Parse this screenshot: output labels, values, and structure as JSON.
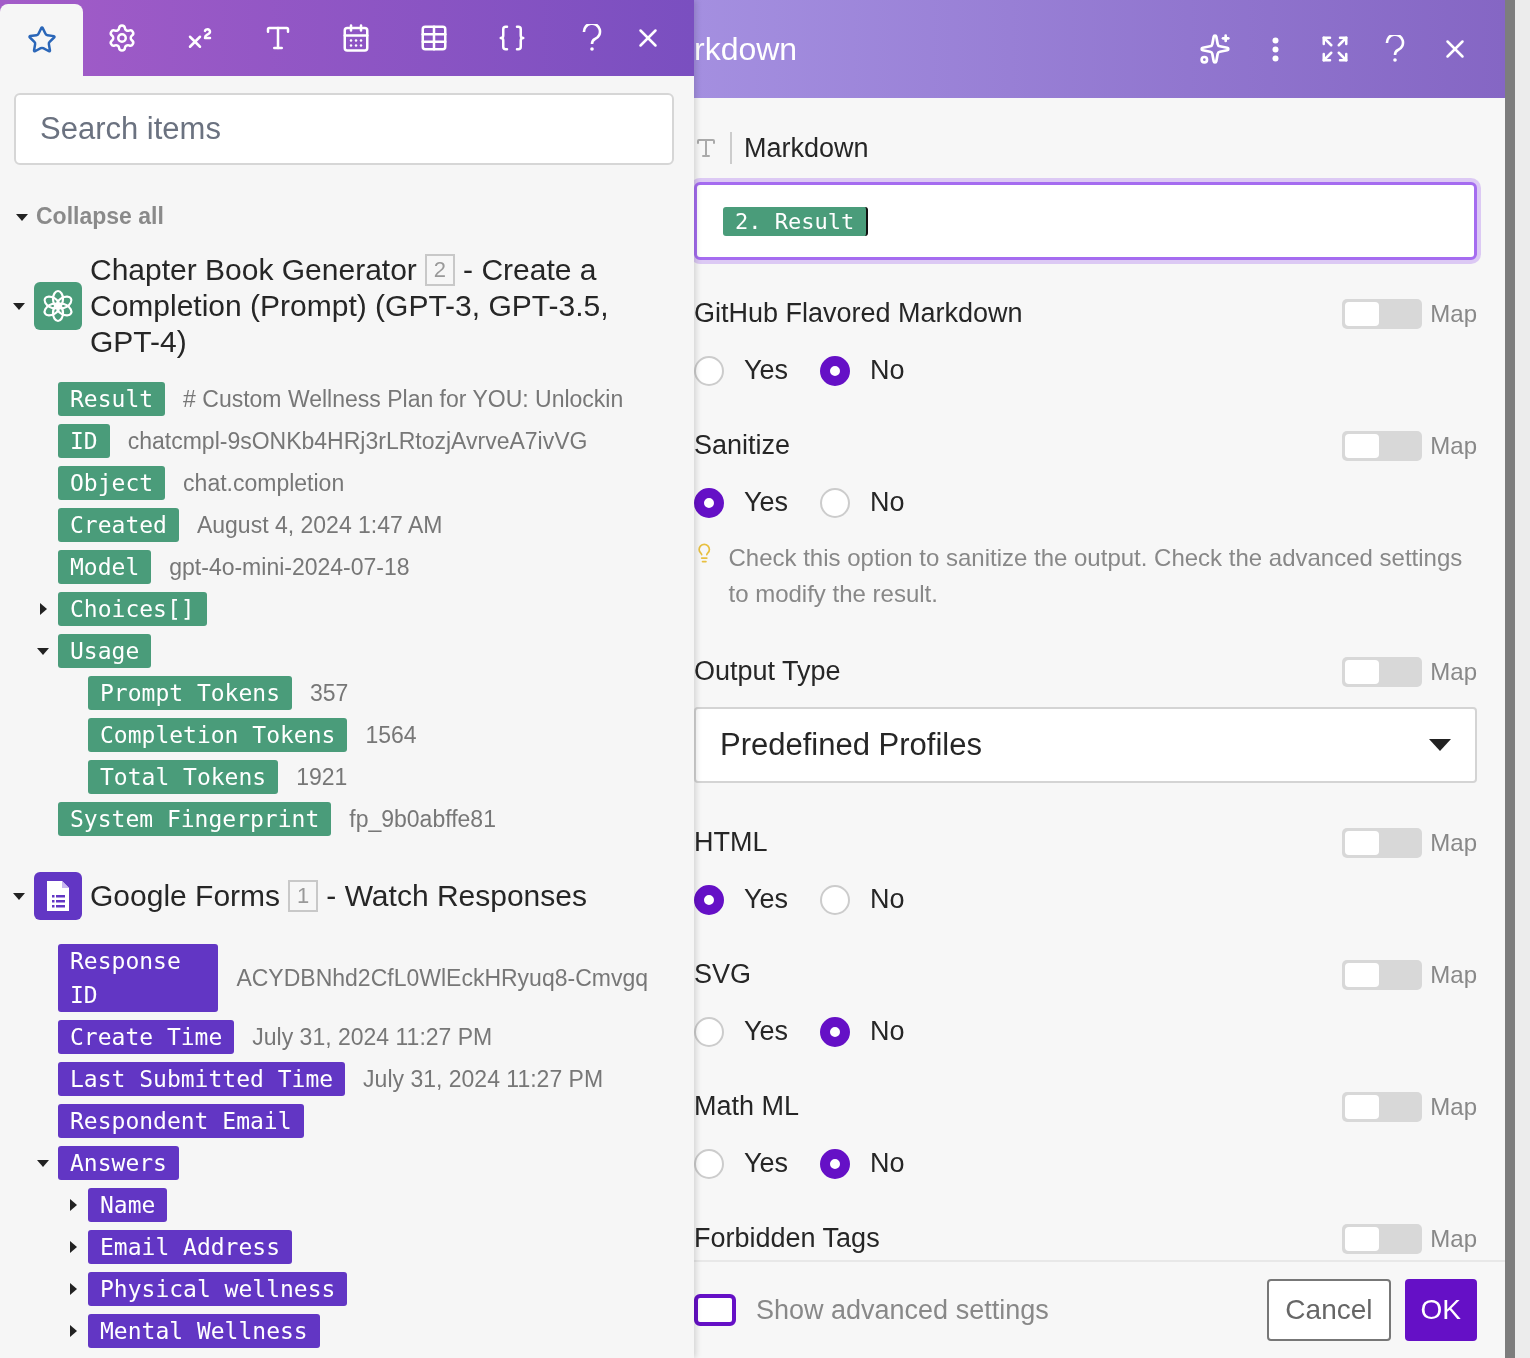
{
  "left_panel": {
    "tabs": [
      {
        "kind": "favorites",
        "selected": true
      },
      {
        "kind": "settings",
        "selected": false
      },
      {
        "kind": "superscript",
        "selected": false
      },
      {
        "kind": "text",
        "selected": false
      },
      {
        "kind": "calendar",
        "selected": false
      },
      {
        "kind": "table",
        "selected": false
      },
      {
        "kind": "braces",
        "selected": false
      }
    ],
    "search": {
      "placeholder": "Search items"
    },
    "collapse_all": "Collapse all",
    "groups": [
      {
        "kind": "openai",
        "color": "#4a9c7a",
        "name": "Chapter Book Generator",
        "number": "2",
        "action": "- Create a Completion (Prompt) (GPT-3, GPT-3.5, GPT-4)",
        "expanded": true,
        "items": [
          {
            "label": "Result",
            "value": "# Custom Wellness Plan for YOU: Unlockin"
          },
          {
            "label": "ID",
            "value": "chatcmpl-9sONKb4HRj3rLRtozjAvrveA7ivVG"
          },
          {
            "label": "Object",
            "value": "chat.completion"
          },
          {
            "label": "Created",
            "value": "August 4, 2024 1:47 AM"
          },
          {
            "label": "Model",
            "value": "gpt-4o-mini-2024-07-18"
          },
          {
            "label": "Choices[]",
            "expanded": false
          },
          {
            "label": "Usage",
            "expanded": true,
            "children": [
              {
                "label": "Prompt Tokens",
                "value": "357"
              },
              {
                "label": "Completion Tokens",
                "value": "1564"
              },
              {
                "label": "Total Tokens",
                "value": "1921"
              }
            ]
          },
          {
            "label": "System Fingerprint",
            "value": "fp_9b0abffe81"
          }
        ]
      },
      {
        "kind": "forms",
        "color": "#6236c4",
        "name": "Google Forms",
        "number": "1",
        "action": "- Watch Responses",
        "expanded": true,
        "items": [
          {
            "label": "Response ID",
            "value": "ACYDBNhd2CfL0WlEckHRyuq8-Cmvgq"
          },
          {
            "label": "Create Time",
            "value": "July 31, 2024 11:27 PM"
          },
          {
            "label": "Last Submitted Time",
            "value": "July 31, 2024 11:27 PM"
          },
          {
            "label": "Respondent Email"
          },
          {
            "label": "Answers",
            "expanded": true,
            "children": [
              {
                "label": "Name",
                "expanded": false
              },
              {
                "label": "Email Address",
                "expanded": false
              },
              {
                "label": "Physical wellness",
                "expanded": false
              },
              {
                "label": "Mental Wellness",
                "expanded": false
              }
            ]
          }
        ]
      }
    ]
  },
  "right_panel": {
    "title": "rkdown",
    "field": {
      "label": "Markdown",
      "token": "2. Result"
    },
    "sections": [
      {
        "kind": "radio",
        "label": "GitHub Flavored Markdown",
        "map_label": "Map",
        "map_on": false,
        "options": [
          {
            "label": "Yes",
            "selected": false
          },
          {
            "label": "No",
            "selected": true
          }
        ]
      },
      {
        "kind": "radio",
        "label": "Sanitize",
        "map_label": "Map",
        "map_on": false,
        "options": [
          {
            "label": "Yes",
            "selected": true
          },
          {
            "label": "No",
            "selected": false
          }
        ],
        "hint": "Check this option to sanitize the output. Check the advanced settings to modify the result."
      },
      {
        "kind": "select",
        "label": "Output Type",
        "map_label": "Map",
        "map_on": false,
        "value": "Predefined Profiles"
      },
      {
        "kind": "radio",
        "label": "HTML",
        "map_label": "Map",
        "map_on": false,
        "options": [
          {
            "label": "Yes",
            "selected": true
          },
          {
            "label": "No",
            "selected": false
          }
        ]
      },
      {
        "kind": "radio",
        "label": "SVG",
        "map_label": "Map",
        "map_on": false,
        "options": [
          {
            "label": "Yes",
            "selected": false
          },
          {
            "label": "No",
            "selected": true
          }
        ]
      },
      {
        "kind": "radio",
        "label": "Math ML",
        "map_label": "Map",
        "map_on": false,
        "options": [
          {
            "label": "Yes",
            "selected": false
          },
          {
            "label": "No",
            "selected": true
          }
        ]
      },
      {
        "kind": "text",
        "label": "Forbidden Tags",
        "map_label": "Map",
        "map_on": false
      }
    ],
    "advanced": {
      "label": "Show advanced settings",
      "checked": false
    },
    "buttons": [
      {
        "label": "Cancel",
        "kind": "secondary"
      },
      {
        "label": "OK",
        "kind": "primary"
      }
    ]
  }
}
